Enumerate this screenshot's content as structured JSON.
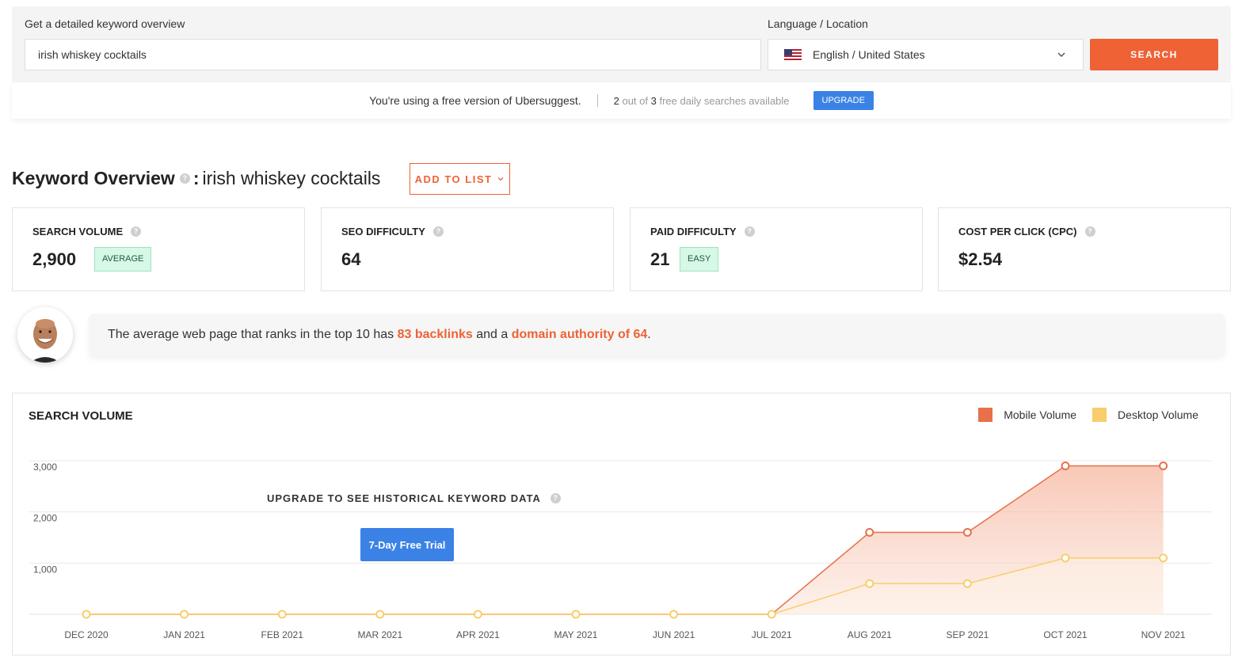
{
  "search": {
    "label": "Get a detailed keyword overview",
    "value": "irish whiskey cocktails",
    "lang_label": "Language / Location",
    "lang_value": "English / United States",
    "button": "SEARCH"
  },
  "free_bar": {
    "text": "You're using a free version of Ubersuggest.",
    "used": "2",
    "out_of": "out of",
    "total": "3",
    "suffix": "free daily searches available",
    "upgrade": "UPGRADE"
  },
  "overview": {
    "title": "Keyword Overview",
    "colon": ":",
    "keyword": "irish whiskey cocktails",
    "add_to_list": "ADD TO LIST",
    "help": "?"
  },
  "cards": [
    {
      "label": "SEARCH VOLUME",
      "value": "2,900",
      "badge": "AVERAGE"
    },
    {
      "label": "SEO DIFFICULTY",
      "value": "64"
    },
    {
      "label": "PAID DIFFICULTY",
      "value": "21",
      "badge": "EASY"
    },
    {
      "label": "COST PER CLICK (CPC)",
      "value": "$2.54"
    }
  ],
  "insight": {
    "pre": "The average web page that ranks in the top 10 has ",
    "backlinks": "83 backlinks",
    "mid": " and a ",
    "authority": "domain authority of 64",
    "post": "."
  },
  "chart_section": {
    "title": "SEARCH VOLUME",
    "upgrade_text": "UPGRADE TO SEE HISTORICAL KEYWORD DATA",
    "trial_button": "7-Day Free Trial"
  },
  "colors": {
    "accent": "#ee6236",
    "mobile": "#e8704a",
    "desktop": "#f9cd6b",
    "blue": "#3b82e6"
  },
  "icons": {
    "help": "question-mark-circle",
    "dropdown": "chevron-down",
    "flag": "us-flag"
  },
  "chart_data": {
    "type": "area",
    "x": [
      "DEC 2020",
      "JAN 2021",
      "FEB 2021",
      "MAR 2021",
      "APR 2021",
      "MAY 2021",
      "JUN 2021",
      "JUL 2021",
      "AUG 2021",
      "SEP 2021",
      "OCT 2021",
      "NOV 2021"
    ],
    "series": [
      {
        "name": "Mobile Volume",
        "values": [
          0,
          0,
          0,
          0,
          0,
          0,
          0,
          0,
          1600,
          1600,
          2900,
          2900
        ]
      },
      {
        "name": "Desktop Volume",
        "values": [
          0,
          0,
          0,
          0,
          0,
          0,
          0,
          0,
          600,
          600,
          1100,
          1100
        ]
      }
    ],
    "yticks": [
      "3,000",
      "2,000",
      "1,000"
    ],
    "ytick_values": [
      3000,
      2000,
      1000
    ],
    "ylim": [
      0,
      3000
    ],
    "grid": true,
    "legend": "top-right"
  }
}
